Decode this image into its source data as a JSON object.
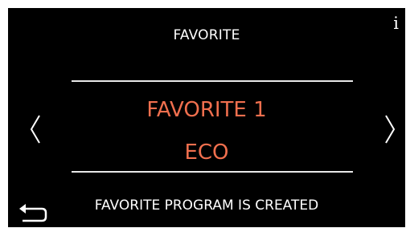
{
  "screen": {
    "title": "FAVORITE",
    "favorite_name": "FAVORITE 1",
    "favorite_program": "ECO",
    "status_message": "FAVORITE PROGRAM IS CREATED",
    "info_glyph": "i"
  },
  "icons": {
    "info": "info-icon",
    "prev": "chevron-left-icon",
    "next": "chevron-right-icon",
    "back": "back-arrow-icon"
  },
  "colors": {
    "background": "#000000",
    "text": "#ffffff",
    "accent": "#f06f4e",
    "divider": "#e8e8e8"
  }
}
